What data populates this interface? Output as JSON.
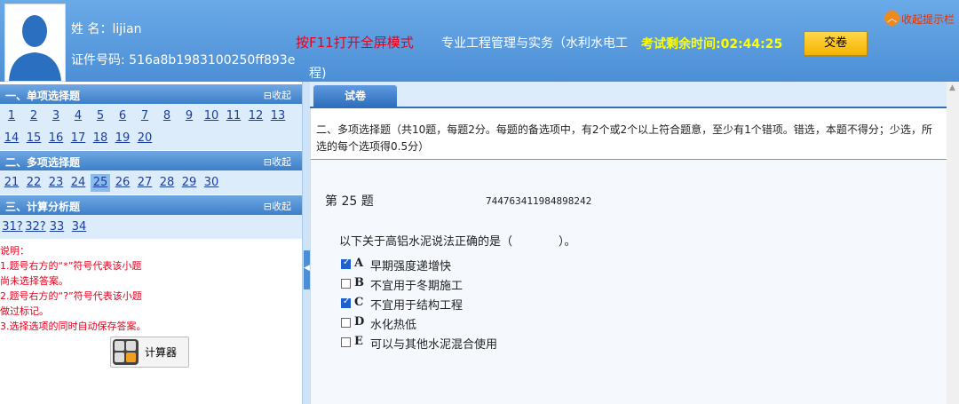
{
  "header": {
    "name_label": "姓 名：lijian",
    "id_label": "证件号码: 516a8b1983100250ff893e",
    "fullscreen_hint": "按F11打开全屏模式",
    "subject_line1": "专业工程管理与实务（水利水电工",
    "subject_line2": "程)",
    "timer": "考试剩余时间:02:44:25",
    "submit_label": "交卷",
    "collapse_tip_label": "收起提示栏"
  },
  "sidebar": {
    "sections": [
      {
        "title": "一、单项选择题",
        "collapse_label": "收起",
        "items": [
          "1",
          "2",
          "3",
          "4",
          "5",
          "6",
          "7",
          "8",
          "9",
          "10",
          "11",
          "12",
          "13",
          "14",
          "15",
          "16",
          "17",
          "18",
          "19",
          "20"
        ]
      },
      {
        "title": "二、多项选择题",
        "collapse_label": "收起",
        "items": [
          "21",
          "22",
          "23",
          "24",
          "25",
          "26",
          "27",
          "28",
          "29",
          "30"
        ],
        "current": "25"
      },
      {
        "title": "三、计算分析题",
        "collapse_label": "收起",
        "items": [
          "31?",
          "32?",
          "33",
          "34"
        ]
      }
    ],
    "notes": [
      "说明：",
      "1.题号右方的“*”符号代表该小题",
      "尚未选择答案。",
      "2.题号右方的“?”符号代表该小题",
      "做过标记。",
      "3.选择选项的同时自动保存答案。"
    ],
    "calculator_label": "计算器"
  },
  "main": {
    "tab_label": "试卷",
    "instructions": "二、多项选择题（共10题，每题2分。每题的备选项中，有2个或2个以上符合题意，至少有1个错项。错选，本题不得分；少选，所选的每个选项得0.5分）",
    "question_title": "第 25 题",
    "question_id": "744763411984898242",
    "stem": "以下关于高铝水泥说法正确的是（　　　　）。",
    "options": [
      {
        "key": "A",
        "text": "早期强度递增快",
        "checked": true
      },
      {
        "key": "B",
        "text": "不宜用于冬期施工",
        "checked": false
      },
      {
        "key": "C",
        "text": "不宜用于结构工程",
        "checked": true
      },
      {
        "key": "D",
        "text": "水化热低",
        "checked": false
      },
      {
        "key": "E",
        "text": "可以与其他水泥混合使用",
        "checked": false
      }
    ]
  },
  "colors": {
    "header_bg": "#5b9ee0",
    "timer": "#ffff00",
    "fullscreen_hint": "#e8001c",
    "submit_bg": "#f5b400"
  }
}
